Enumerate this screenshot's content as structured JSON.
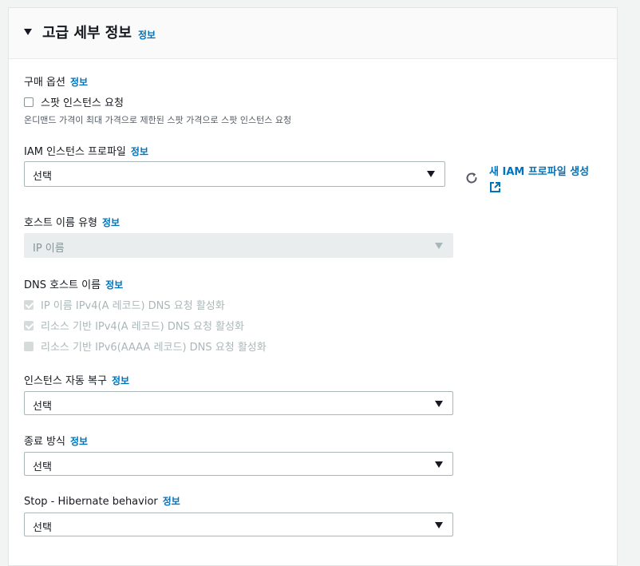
{
  "section": {
    "title": "고급 세부 정보",
    "info": "정보"
  },
  "purchase_option": {
    "label": "구매 옵션",
    "info": "정보",
    "checkbox_label": "스팟 인스턴스 요청",
    "description": "온디맨드 가격이 최대 가격으로 제한된 스팟 가격으로 스팟 인스턴스 요청"
  },
  "iam_profile": {
    "label": "IAM 인스턴스 프로파일",
    "info": "정보",
    "value": "선택",
    "create_link": "새 IAM 프로파일 생성"
  },
  "hostname_type": {
    "label": "호스트 이름 유형",
    "info": "정보",
    "value": "IP 이름"
  },
  "dns_hostname": {
    "label": "DNS 호스트 이름",
    "info": "정보",
    "options": [
      {
        "label": "IP 이름 IPv4(A 레코드) DNS 요청 활성화",
        "checked": true
      },
      {
        "label": "리소스 기반 IPv4(A 레코드) DNS 요청 활성화",
        "checked": true
      },
      {
        "label": "리소스 기반 IPv6(AAAA 레코드) DNS 요청 활성화",
        "checked": false
      }
    ]
  },
  "auto_recovery": {
    "label": "인스턴스 자동 복구",
    "info": "정보",
    "value": "선택"
  },
  "shutdown_behavior": {
    "label": "종료 방식",
    "info": "정보",
    "value": "선택"
  },
  "stop_hibernate": {
    "label": "Stop - Hibernate behavior",
    "info": "정보",
    "value": "선택"
  }
}
